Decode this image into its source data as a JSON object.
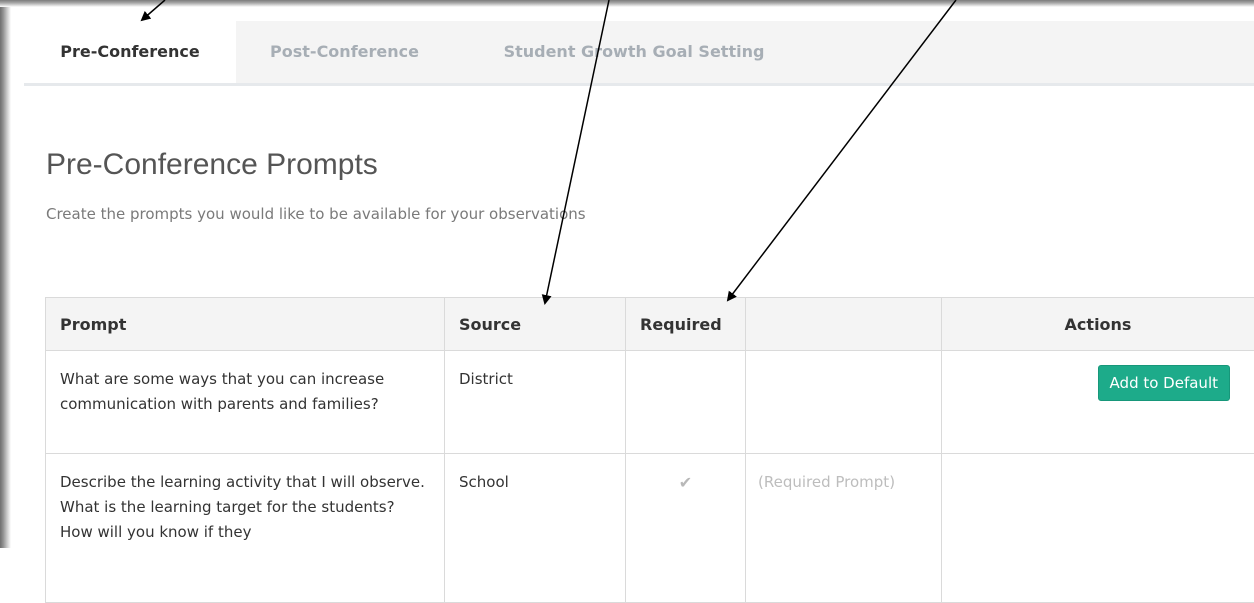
{
  "tabs": [
    {
      "label": "Pre-Conference",
      "active": true
    },
    {
      "label": "Post-Conference",
      "active": false
    },
    {
      "label": "Student Growth Goal Setting",
      "active": false
    }
  ],
  "page": {
    "title": "Pre-Conference Prompts",
    "subtitle": "Create the prompts you would like to be available for your observations"
  },
  "table": {
    "headers": {
      "prompt": "Prompt",
      "source": "Source",
      "required": "Required",
      "blank": "",
      "actions": "Actions"
    },
    "rows": [
      {
        "prompt": "What are some ways that you can increase communication with parents and families?",
        "source": "District",
        "required": "",
        "note": "",
        "action_label": "Add to Default"
      },
      {
        "prompt": "Describe the learning activity that I will observe. What is the learning target for the students? How will you know if they",
        "source": "School",
        "required": "✔",
        "note": "(Required Prompt)",
        "action_label": ""
      }
    ]
  },
  "colors": {
    "accent_button": "#1dab8a",
    "tab_bar": "#f4f4f4",
    "muted_text": "#a7aeb5"
  }
}
